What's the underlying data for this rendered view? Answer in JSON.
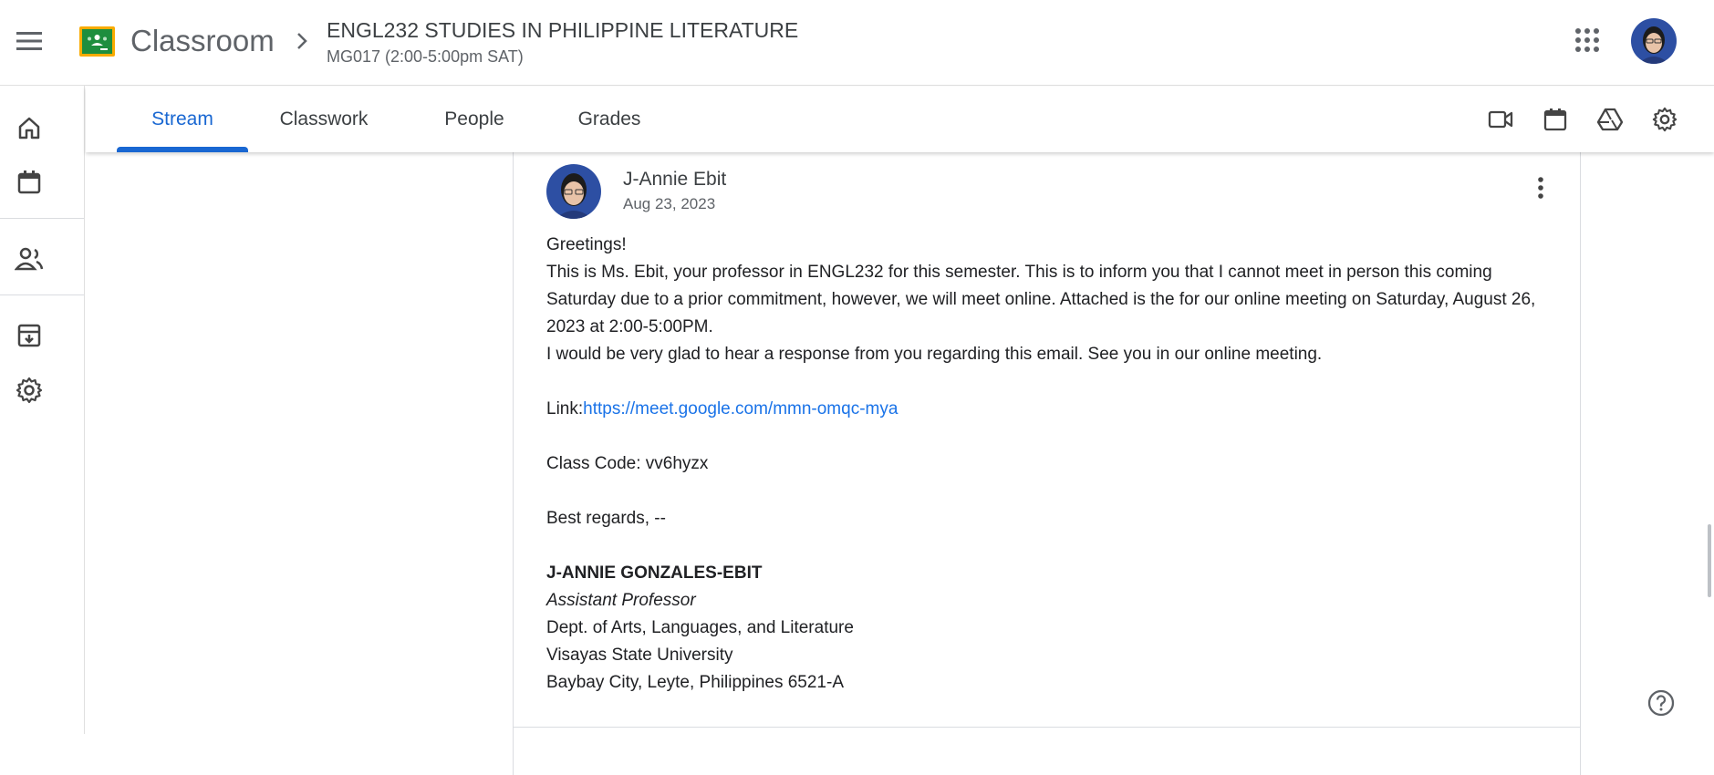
{
  "header": {
    "app_name": "Classroom",
    "class_title": "ENGL232 STUDIES IN PHILIPPINE LITERATURE",
    "class_section": "MG017 (2:00-5:00pm SAT)"
  },
  "tabs": [
    {
      "label": "Stream",
      "active": true
    },
    {
      "label": "Classwork",
      "active": false
    },
    {
      "label": "People",
      "active": false
    },
    {
      "label": "Grades",
      "active": false
    }
  ],
  "post": {
    "author": "J-Annie Ebit",
    "date": "Aug 23, 2023",
    "greeting": "Greetings!",
    "paragraph1": "This is Ms. Ebit, your professor in ENGL232 for this semester. This is to inform you that I cannot meet in person this coming Saturday due to a prior commitment, however, we will meet online. Attached is the for our online meeting on Saturday, August 26, 2023 at 2:00-5:00PM.",
    "paragraph2": "I would be very glad to hear a response from you regarding this email. See you in our online meeting.",
    "link_label": "Link:",
    "link_url": "https://meet.google.com/mmn-omqc-mya",
    "class_code": "Class Code: vv6hyzx",
    "closing": "Best regards, --",
    "signature": {
      "name": "J-ANNIE GONZALES-EBIT",
      "title": "Assistant Professor",
      "dept": "Dept. of Arts, Languages, and Literature",
      "university": "Visayas State University",
      "address": "Baybay City, Leyte, Philippines 6521-A"
    }
  },
  "colors": {
    "accent": "#1967d2",
    "link": "#1a73e8",
    "logo_green": "#1e8e3e",
    "logo_yellow": "#f9ab00"
  }
}
